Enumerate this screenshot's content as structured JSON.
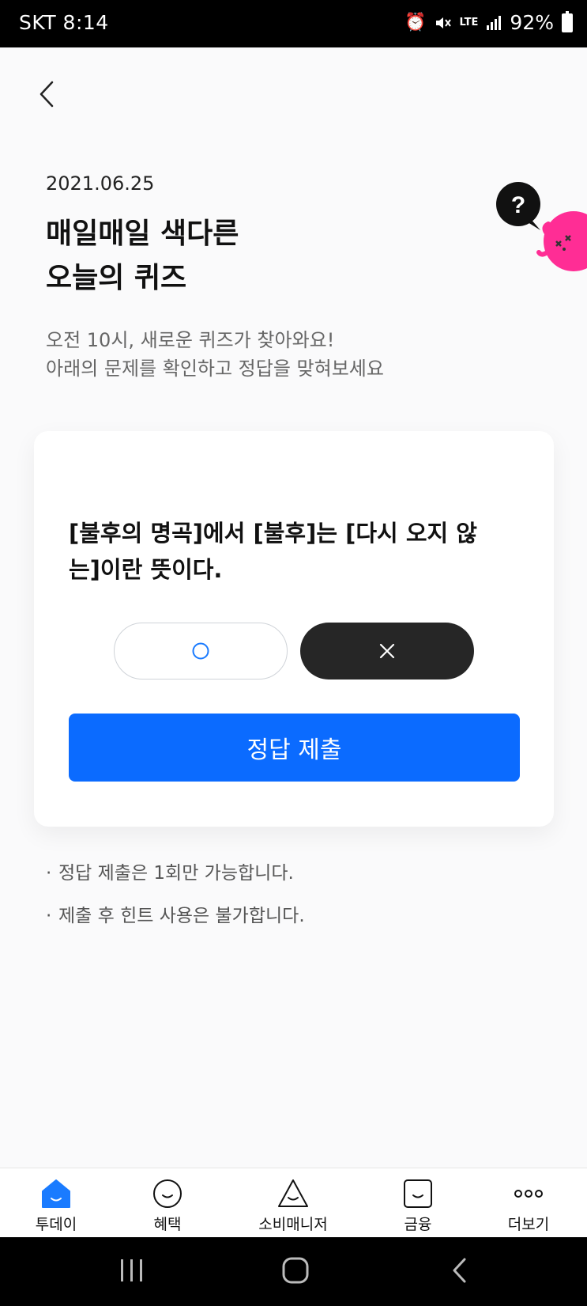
{
  "status_bar": {
    "carrier_time": "SKT 8:14",
    "network": "LTE",
    "battery": "92%"
  },
  "header": {
    "date": "2021.06.25",
    "title_line1": "매일매일 색다른",
    "title_line2": "오늘의 퀴즈",
    "subtitle_line1": "오전 10시, 새로운 퀴즈가 찾아와요!",
    "subtitle_line2": "아래의 문제를 확인하고 정답을 맞혀보세요"
  },
  "quiz": {
    "question_line1": "[불후의 명곡]에서 [불후]는 [다시 오지 않",
    "question_line2": "는]이란 뜻이다.",
    "option_o": "O",
    "option_x": "X",
    "selected": "X",
    "submit_label": "정답 제출"
  },
  "notes": [
    "정답 제출은 1회만 가능합니다.",
    "제출 후 힌트 사용은 불가합니다."
  ],
  "tabs": [
    {
      "label": "투데이",
      "icon": "home-icon",
      "active": true
    },
    {
      "label": "혜택",
      "icon": "smile-circle-icon",
      "active": false
    },
    {
      "label": "소비매니저",
      "icon": "smile-triangle-icon",
      "active": false
    },
    {
      "label": "금융",
      "icon": "smile-square-icon",
      "active": false
    },
    {
      "label": "더보기",
      "icon": "more-dots-icon",
      "active": false
    }
  ],
  "colors": {
    "accent": "#0b6bff",
    "dark_button": "#262626",
    "mascot_pink": "#ff2d95",
    "active_tab": "#1a7bff"
  }
}
